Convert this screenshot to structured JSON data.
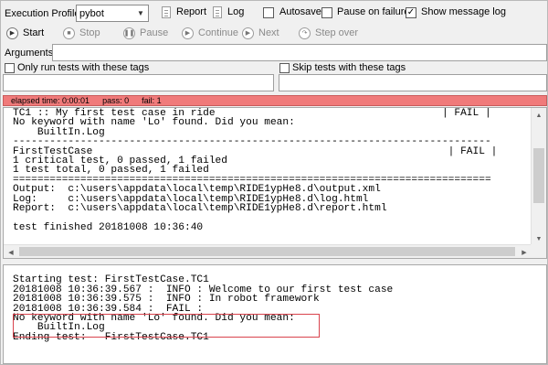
{
  "toolbar": {
    "execution_profile_label": "Execution Profile:",
    "profile_value": "pybot",
    "report_label": "Report",
    "log_label": "Log",
    "autosave_label": "Autosave",
    "autosave_checked": false,
    "pause_on_failure_label": "Pause on failure",
    "pause_on_failure_checked": false,
    "show_message_log_label": "Show message log",
    "show_message_log_checked": true,
    "check_mark": "✓"
  },
  "controls": {
    "start": "Start",
    "stop": "Stop",
    "pause": "Pause",
    "continue": "Continue",
    "next": "Next",
    "step_over": "Step over"
  },
  "arguments": {
    "label": "Arguments:",
    "value": ""
  },
  "tags": {
    "include_label": "Only run tests with these tags",
    "include_checked": false,
    "include_value": "",
    "exclude_label": "Skip tests with these tags",
    "exclude_checked": false,
    "exclude_value": ""
  },
  "status": {
    "elapsed": "elapsed time: 0:00:01",
    "pass": "pass: 0",
    "fail": "fail: 1",
    "color": "#f07a7a"
  },
  "output_console": {
    "lines": [
      "TC1 :: My first test case in ride                                     | FAIL |",
      "No keyword with name 'Lo' found. Did you mean:",
      "    BuiltIn.Log",
      "------------------------------------------------------------------------------",
      "FirstTestCase                                                          | FAIL |",
      "1 critical test, 0 passed, 1 failed",
      "1 test total, 0 passed, 1 failed",
      "==============================================================================",
      "Output:  c:\\users\\appdata\\local\\temp\\RIDE1ypHe8.d\\output.xml",
      "Log:     c:\\users\\appdata\\local\\temp\\RIDE1ypHe8.d\\log.html",
      "Report:  c:\\users\\appdata\\local\\temp\\RIDE1ypHe8.d\\report.html",
      "",
      "test finished 20181008 10:36:40"
    ]
  },
  "message_log": {
    "lines": [
      "",
      "Starting test: FirstTestCase.TC1",
      "20181008 10:36:39.567 :  INFO : Welcome to our first test case",
      "20181008 10:36:39.575 :  INFO : In robot framework",
      "20181008 10:36:39.584 :  FAIL :",
      "No keyword with name 'Lo' found. Did you mean:",
      "    BuiltIn.Log",
      "Ending test:   FirstTestCase.TC1"
    ]
  },
  "icons": {
    "dropdown": "chevron-down-icon",
    "start": "play-icon",
    "stop": "stop-icon",
    "pause": "pause-icon",
    "continue": "continue-icon",
    "next": "next-icon",
    "step_over": "step-over-icon",
    "report": "document-icon",
    "log": "document-icon"
  }
}
